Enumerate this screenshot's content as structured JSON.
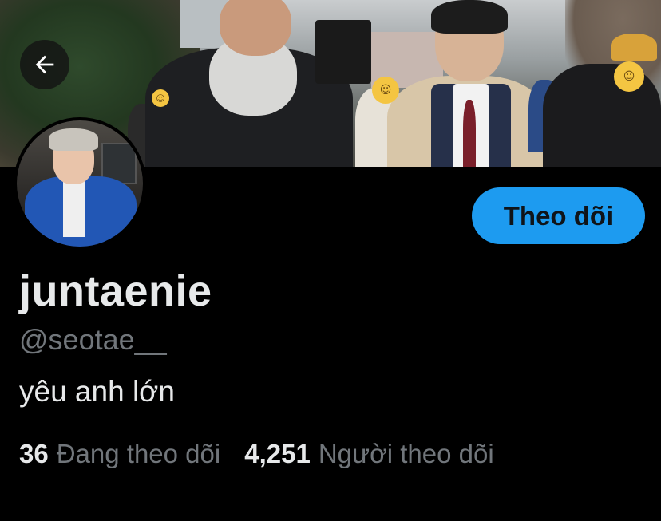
{
  "profile": {
    "display_name": "juntaenie",
    "handle": "@seotae__",
    "bio": "yêu anh lớn"
  },
  "actions": {
    "follow_label": "Theo dõi"
  },
  "stats": {
    "following_count": "36",
    "following_label": "Đang theo dõi",
    "followers_count": "4,251",
    "followers_label": "Người theo dõi"
  },
  "icons": {
    "back": "arrow-left-icon"
  },
  "colors": {
    "background": "#000000",
    "primary_text": "#e7e9ea",
    "secondary_text": "#71767b",
    "accent": "#1d9bf0"
  }
}
